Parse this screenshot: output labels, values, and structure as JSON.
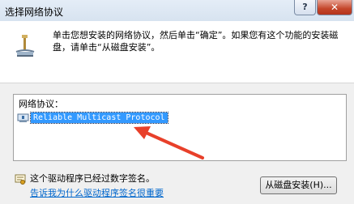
{
  "window": {
    "title": "选择网络协议",
    "help_label": "?",
    "close_label": "✕"
  },
  "instructions": {
    "text": "单击您想安装的网络协议，然后单击“确定”。如果您有这个功能的安装磁盘，请单击“从磁盘安装”。"
  },
  "protocol_list": {
    "label": "网络协议：",
    "items": [
      {
        "label": "Reliable Multicast Protocol",
        "selected": true
      }
    ]
  },
  "footer": {
    "signed_text": "这个驱动程序已经过数字签名。",
    "signing_link": "告诉我为什么驱动程序签名很重要",
    "disk_button_label": "从磁盘安装(H)..."
  },
  "colors": {
    "selection": "#3399ff",
    "link": "#0066cc",
    "arrow": "#e8402a",
    "close_button": "#c4462a"
  },
  "icons": {
    "network": "network-protocol-icon",
    "item": "protocol-item-icon",
    "signature": "digital-signature-icon",
    "arrow": "red-annotation-arrow"
  }
}
